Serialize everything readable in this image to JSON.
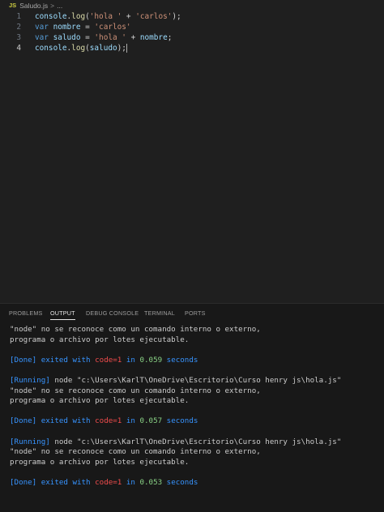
{
  "breadcrumb": {
    "icon": "JS",
    "file": "Saludo.js",
    "separator": ">",
    "more": "..."
  },
  "editor": {
    "lines": [
      {
        "number": "1",
        "tokens": [
          {
            "t": "console",
            "c": "k-obj"
          },
          {
            "t": ".",
            "c": "k-p"
          },
          {
            "t": "log",
            "c": "k-fn"
          },
          {
            "t": "(",
            "c": "k-p"
          },
          {
            "t": "'hola '",
            "c": "k-str"
          },
          {
            "t": " + ",
            "c": "k-p"
          },
          {
            "t": "'carlos'",
            "c": "k-str"
          },
          {
            "t": ");",
            "c": "k-p"
          }
        ]
      },
      {
        "number": "2",
        "tokens": [
          {
            "t": "var",
            "c": "k-kw"
          },
          {
            "t": " ",
            "c": "k-p"
          },
          {
            "t": "nombre",
            "c": "k-var"
          },
          {
            "t": " = ",
            "c": "k-p"
          },
          {
            "t": "'carlos'",
            "c": "k-str"
          }
        ]
      },
      {
        "number": "3",
        "tokens": [
          {
            "t": "var",
            "c": "k-kw"
          },
          {
            "t": " ",
            "c": "k-p"
          },
          {
            "t": "saludo",
            "c": "k-var"
          },
          {
            "t": " = ",
            "c": "k-p"
          },
          {
            "t": "'hola '",
            "c": "k-str"
          },
          {
            "t": " + ",
            "c": "k-p"
          },
          {
            "t": "nombre",
            "c": "k-var"
          },
          {
            "t": ";",
            "c": "k-p"
          }
        ]
      },
      {
        "number": "4",
        "active": true,
        "tokens": [
          {
            "t": "console",
            "c": "k-obj"
          },
          {
            "t": ".",
            "c": "k-p"
          },
          {
            "t": "log",
            "c": "k-fn"
          },
          {
            "t": "(",
            "c": "k-p"
          },
          {
            "t": "saludo",
            "c": "k-var"
          },
          {
            "t": ");",
            "c": "k-p"
          }
        ]
      }
    ]
  },
  "panel": {
    "tabs": [
      {
        "label": "PROBLEMS",
        "active": false
      },
      {
        "label": "OUTPUT",
        "active": true
      },
      {
        "label": "DEBUG CONSOLE",
        "active": false
      },
      {
        "label": "TERMINAL",
        "active": false
      },
      {
        "label": "PORTS",
        "active": false
      }
    ],
    "output_lines": [
      [
        {
          "t": "\"node\" no se reconoce como un comando interno o externo,",
          "c": ""
        }
      ],
      [
        {
          "t": "programa o archivo por lotes ejecutable.",
          "c": ""
        }
      ],
      [],
      [
        {
          "t": "[Done]",
          "c": "o-blue"
        },
        {
          "t": " exited with ",
          "c": "o-blue"
        },
        {
          "t": "code=1",
          "c": "o-red"
        },
        {
          "t": " in ",
          "c": "o-blue"
        },
        {
          "t": "0.059",
          "c": "o-green"
        },
        {
          "t": " seconds",
          "c": "o-blue"
        }
      ],
      [],
      [
        {
          "t": "[Running]",
          "c": "o-blue"
        },
        {
          "t": " node \"c:\\Users\\KarlT\\OneDrive\\Escritorio\\Curso henry js\\hola.js\"",
          "c": ""
        }
      ],
      [
        {
          "t": "\"node\" no se reconoce como un comando interno o externo,",
          "c": ""
        }
      ],
      [
        {
          "t": "programa o archivo por lotes ejecutable.",
          "c": ""
        }
      ],
      [],
      [
        {
          "t": "[Done]",
          "c": "o-blue"
        },
        {
          "t": " exited with ",
          "c": "o-blue"
        },
        {
          "t": "code=1",
          "c": "o-red"
        },
        {
          "t": " in ",
          "c": "o-blue"
        },
        {
          "t": "0.057",
          "c": "o-green"
        },
        {
          "t": " seconds",
          "c": "o-blue"
        }
      ],
      [],
      [
        {
          "t": "[Running]",
          "c": "o-blue"
        },
        {
          "t": " node \"c:\\Users\\KarlT\\OneDrive\\Escritorio\\Curso henry js\\hola.js\"",
          "c": ""
        }
      ],
      [
        {
          "t": "\"node\" no se reconoce como un comando interno o externo,",
          "c": ""
        }
      ],
      [
        {
          "t": "programa o archivo por lotes ejecutable.",
          "c": ""
        }
      ],
      [],
      [
        {
          "t": "[Done]",
          "c": "o-blue"
        },
        {
          "t": " exited with ",
          "c": "o-blue"
        },
        {
          "t": "code=1",
          "c": "o-red"
        },
        {
          "t": " in ",
          "c": "o-blue"
        },
        {
          "t": "0.053",
          "c": "o-green"
        },
        {
          "t": " seconds",
          "c": "o-blue"
        }
      ]
    ]
  }
}
